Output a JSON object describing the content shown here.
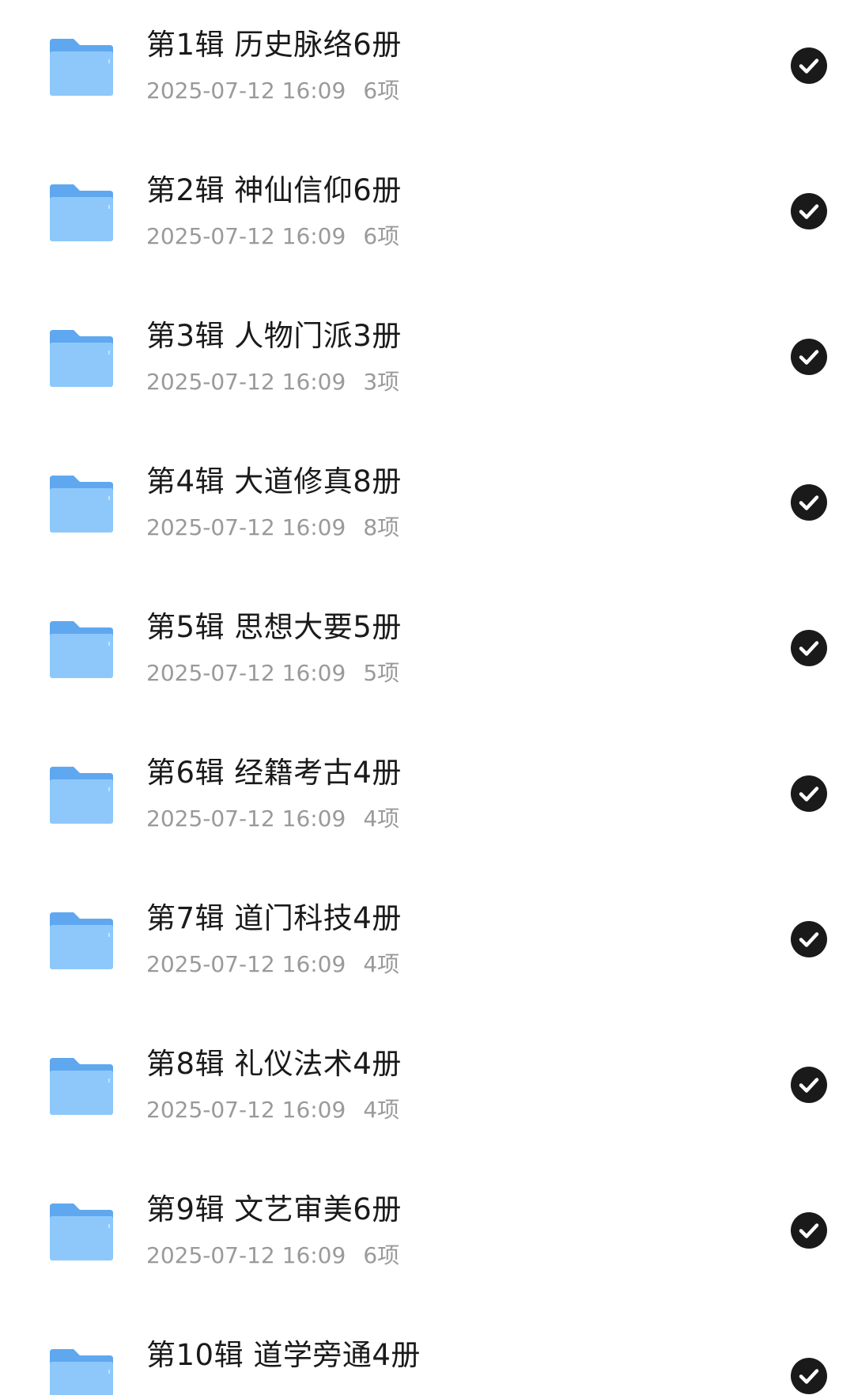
{
  "folders": [
    {
      "name": "第1辑 历史脉络6册",
      "date": "2025-07-12 16:09",
      "count": "6项",
      "selected": true,
      "icon": "folder-icon",
      "check_icon": "check-circle-icon"
    },
    {
      "name": "第2辑 神仙信仰6册",
      "date": "2025-07-12 16:09",
      "count": "6项",
      "selected": true,
      "icon": "folder-icon",
      "check_icon": "check-circle-icon"
    },
    {
      "name": "第3辑 人物门派3册",
      "date": "2025-07-12 16:09",
      "count": "3项",
      "selected": true,
      "icon": "folder-icon",
      "check_icon": "check-circle-icon"
    },
    {
      "name": "第4辑 大道修真8册",
      "date": "2025-07-12 16:09",
      "count": "8项",
      "selected": true,
      "icon": "folder-icon",
      "check_icon": "check-circle-icon"
    },
    {
      "name": "第5辑 思想大要5册",
      "date": "2025-07-12 16:09",
      "count": "5项",
      "selected": true,
      "icon": "folder-icon",
      "check_icon": "check-circle-icon"
    },
    {
      "name": "第6辑 经籍考古4册",
      "date": "2025-07-12 16:09",
      "count": "4项",
      "selected": true,
      "icon": "folder-icon",
      "check_icon": "check-circle-icon"
    },
    {
      "name": "第7辑 道门科技4册",
      "date": "2025-07-12 16:09",
      "count": "4项",
      "selected": true,
      "icon": "folder-icon",
      "check_icon": "check-circle-icon"
    },
    {
      "name": "第8辑 礼仪法术4册",
      "date": "2025-07-12 16:09",
      "count": "4项",
      "selected": true,
      "icon": "folder-icon",
      "check_icon": "check-circle-icon"
    },
    {
      "name": "第9辑 文艺审美6册",
      "date": "2025-07-12 16:09",
      "count": "6项",
      "selected": true,
      "icon": "folder-icon",
      "check_icon": "check-circle-icon"
    },
    {
      "name": "第10辑 道学旁通4册",
      "selected": true,
      "icon": "folder-icon",
      "check_icon": "check-circle-icon"
    }
  ],
  "colors": {
    "folder_back": "#5FA8F0",
    "folder_front": "#8EC8FB",
    "check_bg": "#1A1A1A",
    "title_text": "#1A1A1A",
    "meta_text": "#9A9A9A"
  }
}
